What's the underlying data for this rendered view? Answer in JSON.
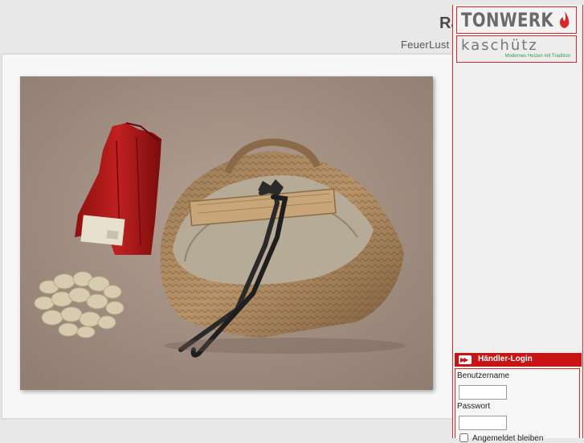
{
  "header": {
    "title": "Ra",
    "subtitle": "FeuerLust +"
  },
  "sidebar": {
    "logos": [
      {
        "name": "TONWERK",
        "accent": "#d42a2a"
      },
      {
        "name": "kaschütz",
        "tagline": "Modernes Heizen mit Tradition",
        "accent": "#3a9a3a"
      }
    ],
    "login": {
      "title": "Händler-Login",
      "username_label": "Benutzername",
      "username_value": "",
      "password_label": "Passwort",
      "password_value": "",
      "remember_label": "Angemeldet bleiben",
      "remember_checked": false,
      "arrow_icon": "double-chevron-right-icon"
    }
  },
  "main": {
    "photo_alt": ""
  },
  "colors": {
    "brand_red": "#c81414",
    "frame_border": "#d42a2a",
    "background": "#e8e8e8"
  }
}
